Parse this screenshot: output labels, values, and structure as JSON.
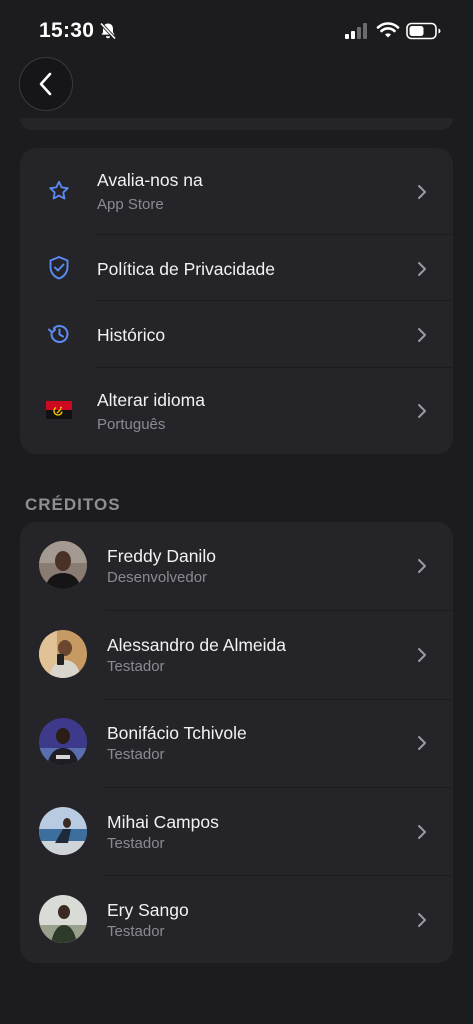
{
  "status_bar": {
    "time": "15:30"
  },
  "settings_items": [
    {
      "title": "Avalia-nos na",
      "subtitle": "App Store",
      "icon": "star-icon"
    },
    {
      "title": "Política de Privacidade",
      "subtitle": "",
      "icon": "shield-check-icon"
    },
    {
      "title": "Histórico",
      "subtitle": "",
      "icon": "history-icon"
    },
    {
      "title": "Alterar idioma",
      "subtitle": "Português",
      "icon": "angola-flag-icon"
    }
  ],
  "credits": {
    "header": "CRÉDITOS",
    "people": [
      {
        "name": "Freddy Danilo",
        "role": "Desenvolvedor"
      },
      {
        "name": "Alessandro de Almeida",
        "role": "Testador"
      },
      {
        "name": "Bonifácio Tchivole",
        "role": "Testador"
      },
      {
        "name": "Mihai Campos",
        "role": "Testador"
      },
      {
        "name": "Ery Sango",
        "role": "Testador"
      }
    ]
  },
  "colors": {
    "background": "#1c1c1e",
    "card": "#252529",
    "accent": "#5b8cf5",
    "muted_text": "#8a8a90"
  }
}
